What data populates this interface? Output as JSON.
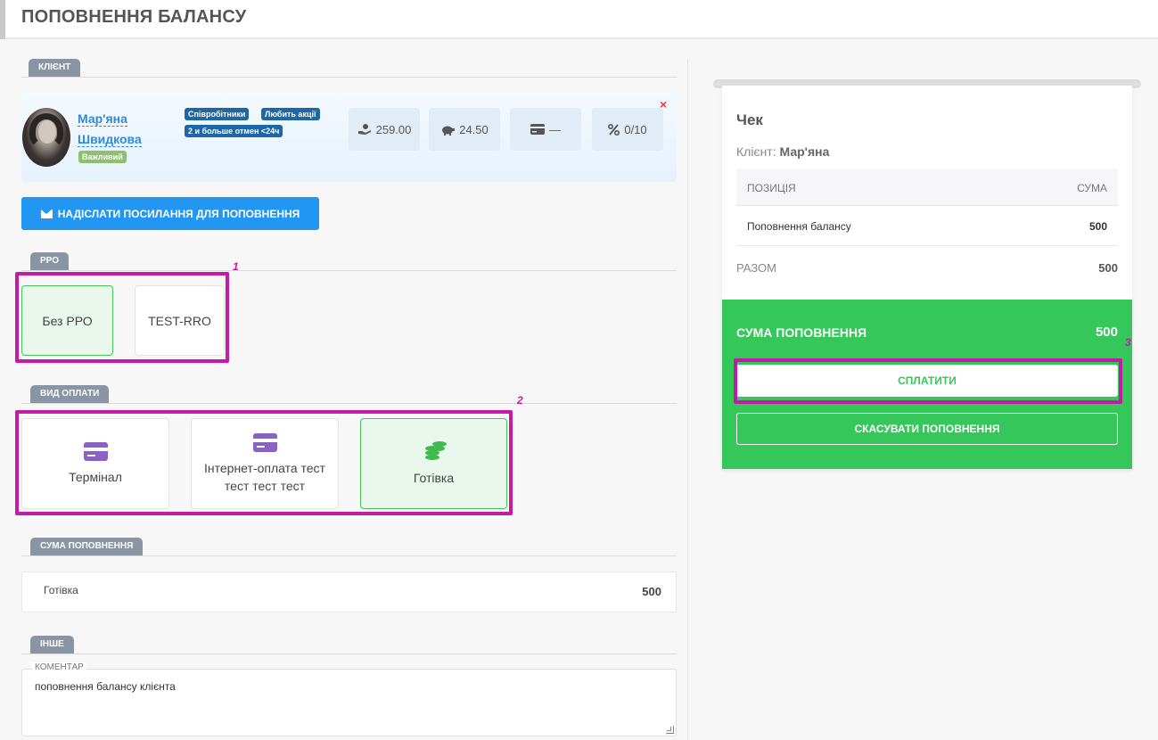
{
  "page": {
    "title": "ПОПОВНЕННЯ БАЛАНСУ"
  },
  "client_section": {
    "label": "КЛІЄНТ",
    "first_name": "Мар'яна",
    "last_name": "Швидкова",
    "badge": "Важливий",
    "tags": [
      "Співробітники",
      "Любить акції",
      "2 и больше отмен <24ч"
    ],
    "stats": {
      "balance": "259.00",
      "bonus": "24.50",
      "card": "—",
      "discount": "0/10"
    },
    "close_icon": "×"
  },
  "send_link_button": {
    "label": "НАДІСЛАТИ ПОСИЛАННЯ ДЛЯ ПОПОВНЕННЯ",
    "icon": "envelope-icon"
  },
  "rro_section": {
    "label": "РРО",
    "options": [
      "Без РРО",
      "TEST-RRO"
    ],
    "selected": "Без РРО"
  },
  "payment_section": {
    "label": "ВИД ОПЛАТИ",
    "options": [
      {
        "label": "Термінал",
        "icon": "credit-card-icon"
      },
      {
        "label": "Інтернет-оплата тест тест тест тест",
        "icon": "credit-card-icon"
      },
      {
        "label": "Готівка",
        "icon": "coins-icon"
      }
    ],
    "selected": "Готівка"
  },
  "amount_section": {
    "label": "СУМА ПОПОВНЕННЯ",
    "method": "Готівка",
    "value": "500"
  },
  "other_section": {
    "label": "ІНШЕ",
    "comment_label": "КОМЕНТАР",
    "comment_value": "поповнення балансу клієнта"
  },
  "receipt": {
    "title": "Чек",
    "client_prefix": "Клієнт:",
    "client_name": "Мар'яна",
    "table_headers": [
      "ПОЗИЦІЯ",
      "СУМА"
    ],
    "rows": [
      {
        "position": "Поповнення балансу",
        "amount": "500"
      }
    ],
    "total_label": "РАЗОМ",
    "total_value": "500",
    "topup_label": "СУМА ПОПОВНЕННЯ",
    "topup_value": "500",
    "pay_button": "СПЛАТИТИ",
    "cancel_button": "СКАСУВАТИ ПОПОВНЕННЯ"
  },
  "annotations": [
    "1",
    "2",
    "3"
  ],
  "colors": {
    "accent_blue": "#2196f3",
    "success_green": "#35c759",
    "highlight_magenta": "#c51aa8",
    "tag_blue": "#1d66a8",
    "badge_green": "#8cc26b",
    "section_label_gray": "#8a94a3"
  }
}
